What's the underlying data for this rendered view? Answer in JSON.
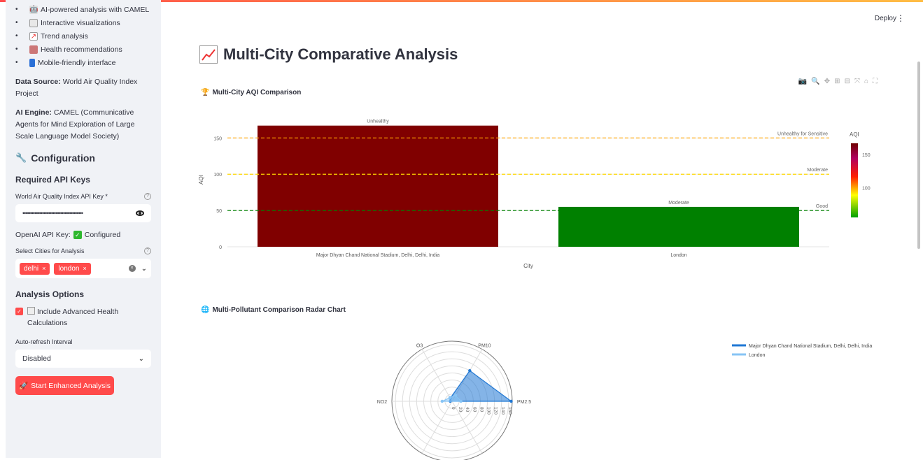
{
  "sidebar": {
    "features": [
      {
        "icon": "robot-icon",
        "label": "AI-powered analysis with CAMEL"
      },
      {
        "icon": "bar-chart-icon",
        "label": "Interactive visualizations"
      },
      {
        "icon": "trend-chart-icon",
        "label": "Trend analysis"
      },
      {
        "icon": "health-icon",
        "label": "Health recommendations"
      },
      {
        "icon": "phone-icon",
        "label": "Mobile-friendly interface"
      }
    ],
    "data_source_label": "Data Source:",
    "data_source_value": "World Air Quality Index Project",
    "ai_engine_label": "AI Engine:",
    "ai_engine_value": "CAMEL (Communicative Agents for Mind Exploration of Large Scale Language Model Society)",
    "configuration_title": "Configuration",
    "required_keys_title": "Required API Keys",
    "waqi_label": "World Air Quality Index API Key *",
    "waqi_value": "••••••••••••••••••••••••••••••••••••••••",
    "openai_label": "OpenAI API Key:",
    "openai_status": "Configured",
    "cities_label": "Select Cities for Analysis",
    "cities": [
      "delhi",
      "london"
    ],
    "analysis_options_title": "Analysis Options",
    "advanced_health_label": "Include Advanced Health Calculations",
    "advanced_health_checked": true,
    "refresh_label": "Auto-refresh Interval",
    "refresh_value": "Disabled",
    "start_button": "Start Enhanced Analysis"
  },
  "header": {
    "deploy": "Deploy"
  },
  "main": {
    "page_title": "Multi-City Comparative Analysis",
    "bar_chart_title": "Multi-City AQI Comparison",
    "radar_chart_title": "Multi-Pollutant Comparison Radar Chart"
  },
  "chart_data": [
    {
      "type": "bar",
      "title": "",
      "categories": [
        "Major Dhyan Chand National Stadium, Delhi, Delhi, India",
        "London"
      ],
      "values": [
        167,
        55
      ],
      "data_labels": [
        "Unhealthy",
        "Moderate"
      ],
      "bar_colors": [
        "#800000",
        "#008000"
      ],
      "xlabel": "City",
      "ylabel": "AQI",
      "ylim": [
        0,
        185
      ],
      "yticks": [
        0,
        50,
        100,
        150
      ],
      "reference_lines": [
        {
          "y": 150,
          "label": "Unhealthy for Sensitive",
          "color": "#ffa500"
        },
        {
          "y": 100,
          "label": "Moderate",
          "color": "#ffd700"
        },
        {
          "y": 50,
          "label": "Good",
          "color": "#008000"
        }
      ],
      "colorbar": {
        "title": "AQI",
        "ticks": [
          100,
          150
        ]
      }
    },
    {
      "type": "radar",
      "axes": [
        "PM2.5",
        "PM10",
        "O3",
        "NO2"
      ],
      "radial_ticks": [
        0,
        20,
        40,
        60,
        80,
        100,
        120,
        140,
        160
      ],
      "range": [
        0,
        170
      ],
      "series": [
        {
          "name": "Major Dhyan Chand National Stadium, Delhi, Delhi, India",
          "values": [
            167,
            100,
            10,
            5
          ],
          "color": "#1f77d4"
        },
        {
          "name": "London",
          "values": [
            25,
            20,
            12,
            28
          ],
          "color": "#87c4f5"
        }
      ]
    }
  ]
}
